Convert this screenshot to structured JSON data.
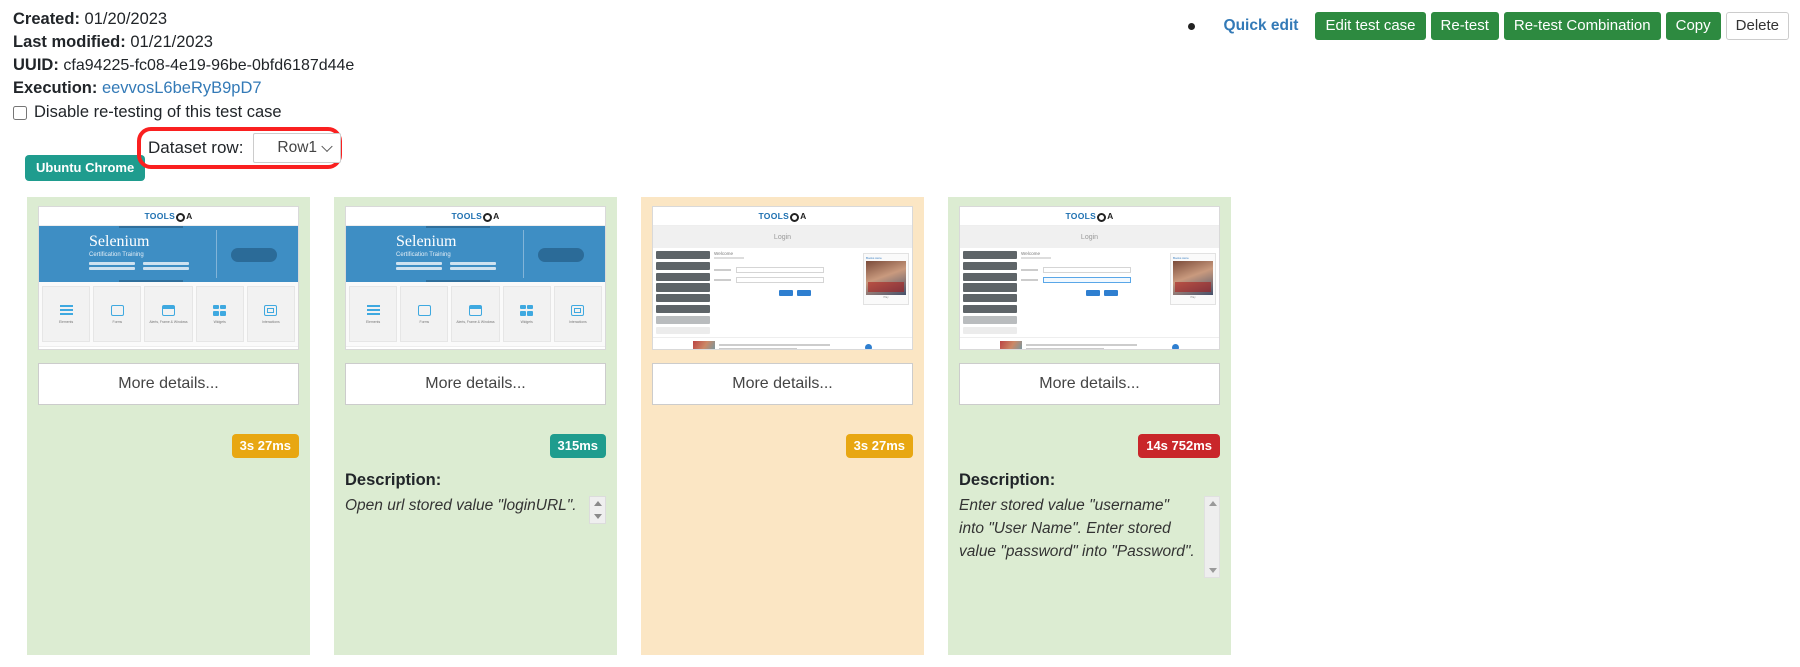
{
  "meta": {
    "created_label": "Created:",
    "created_value": "01/20/2023",
    "modified_label": "Last modified:",
    "modified_value": "01/21/2023",
    "uuid_label": "UUID:",
    "uuid_value": "cfa94225-fc08-4e19-96be-0bfd6187d44e",
    "execution_label": "Execution:",
    "execution_value": "eevvosL6beRyB9pD7",
    "disable_checkbox_label": "Disable re-testing of this test case",
    "disable_checked": false
  },
  "toolbar": {
    "quick_edit": "Quick edit",
    "edit_test_case": "Edit test case",
    "retest": "Re-test",
    "retest_combination": "Re-test Combination",
    "copy": "Copy",
    "delete": "Delete"
  },
  "environment": {
    "badge": "Ubuntu Chrome"
  },
  "dataset": {
    "label": "Dataset row:",
    "selected": "Row1",
    "options": [
      "Row1"
    ]
  },
  "cards": [
    {
      "bg": "green",
      "thumb_type": "home",
      "thumb_logo": "TOOLSQA",
      "hero_title": "Selenium",
      "hero_sub": "Certification Training",
      "tiles": [
        "Elements",
        "Forms",
        "Alerts, Frame & Windows",
        "Widgets",
        "Interactions"
      ],
      "more_details": "More details...",
      "duration": "3s 27ms",
      "duration_color": "orange",
      "description_label": "",
      "description": "",
      "has_description": false,
      "scroll": "none"
    },
    {
      "bg": "green",
      "thumb_type": "home",
      "thumb_logo": "TOOLSQA",
      "hero_title": "Selenium",
      "hero_sub": "Certification Training",
      "tiles": [
        "Elements",
        "Forms",
        "Alerts, Frame & Windows",
        "Widgets",
        "Interactions"
      ],
      "more_details": "More details...",
      "duration": "315ms",
      "duration_color": "teal",
      "description_label": "Description:",
      "description": "Open url stored value \"loginURL\".",
      "has_description": true,
      "scroll": "spinner"
    },
    {
      "bg": "orange",
      "thumb_type": "login",
      "thumb_logo": "TOOLSQA",
      "login_title": "Login",
      "more_details": "More details...",
      "duration": "3s 27ms",
      "duration_color": "orange",
      "description_label": "",
      "description": "",
      "has_description": false,
      "scroll": "none"
    },
    {
      "bg": "green",
      "thumb_type": "login",
      "thumb_logo": "TOOLSQA",
      "login_title": "Login",
      "more_details": "More details...",
      "duration": "14s 752ms",
      "duration_color": "red",
      "description_label": "Description:",
      "description": "Enter stored value \"username\" into \"User Name\".\nEnter stored value \"password\" into \"Password\".",
      "has_description": true,
      "scroll": "scrollbar"
    }
  ],
  "colors": {
    "green_card": "#dcecd2",
    "orange_card": "#fbe6c4",
    "btn_green": "#2d8a40",
    "link_blue": "#337ab7",
    "teal": "#1f9c8e",
    "highlight_red": "#fa2020",
    "duration_orange": "#e8a712",
    "duration_red": "#c9262a"
  }
}
